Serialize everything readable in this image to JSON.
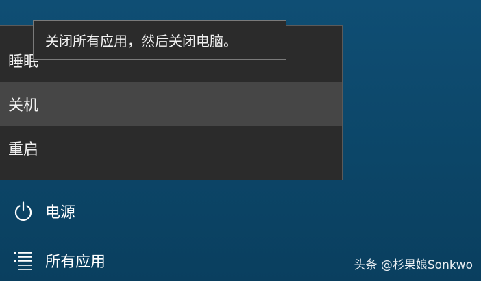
{
  "tooltip": {
    "text": "关闭所有应用，然后关闭电脑。"
  },
  "power_menu": {
    "items": [
      {
        "label": "睡眠"
      },
      {
        "label": "关机"
      },
      {
        "label": "重启"
      }
    ]
  },
  "start_menu": {
    "power_label": "电源",
    "all_apps_label": "所有应用"
  },
  "watermark": {
    "text": "头条 @杉果娘Sonkwo"
  },
  "colors": {
    "desktop_bg": "#0c4668",
    "menu_bg": "#2b2b2b",
    "menu_hover": "#464646",
    "text": "#ffffff"
  },
  "icons": {
    "power": "power-icon",
    "all_apps": "list-icon"
  }
}
